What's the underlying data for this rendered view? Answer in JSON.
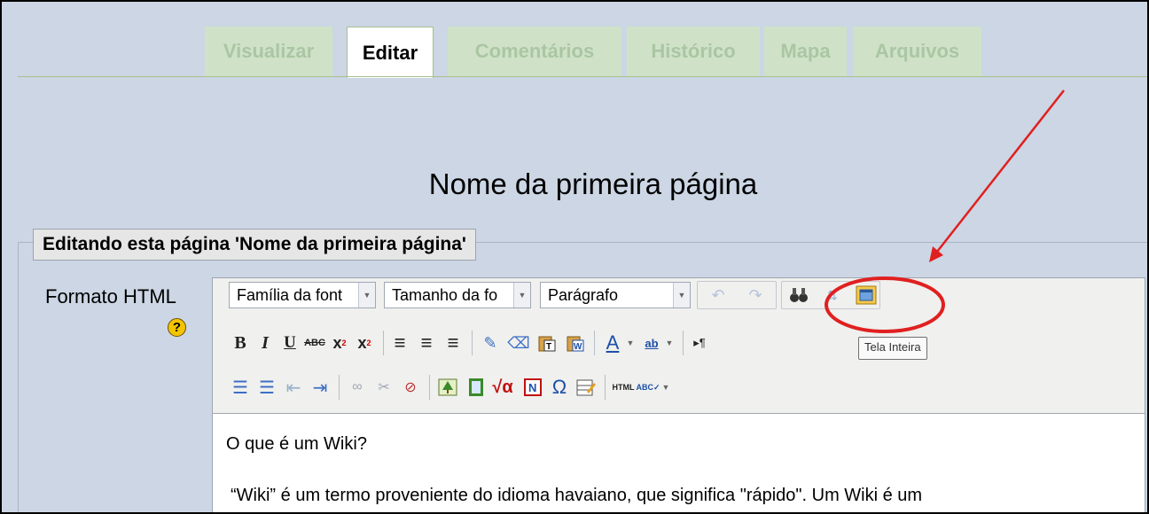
{
  "tabs": [
    {
      "label": "Visualizar",
      "active": false
    },
    {
      "label": "Editar",
      "active": true
    },
    {
      "label": "Comentários",
      "active": false
    },
    {
      "label": "Histórico",
      "active": false
    },
    {
      "label": "Mapa",
      "active": false
    },
    {
      "label": "Arquivos",
      "active": false
    }
  ],
  "page_title": "Nome da primeira página",
  "form": {
    "legend": "Editando esta página 'Nome da primeira página'",
    "format_label": "Formato HTML",
    "help_icon": "?"
  },
  "toolbar": {
    "font_family": "Família da font",
    "font_size": "Tamanho da fo",
    "block_format": "Parágrafo",
    "fullscreen_tooltip": "Tela Inteira"
  },
  "content": {
    "paragraph1": "O que é um Wiki?",
    "paragraph2": "“Wiki” é um termo proveniente do idioma havaiano, que significa \"rápido\". Um Wiki é um"
  },
  "colors": {
    "background": "#ccd6e4",
    "tab_inactive": "#cfe2c8",
    "tab_inactive_text": "#aac6a2",
    "annotation": "#e02020"
  }
}
